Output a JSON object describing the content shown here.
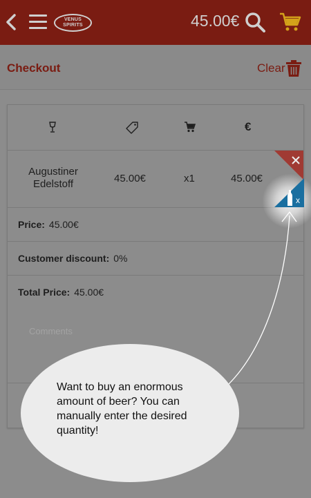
{
  "header": {
    "logo_line1": "VENUS",
    "logo_line2": "SPIRITS",
    "cart_total": "45.00€"
  },
  "subheader": {
    "title": "Checkout",
    "clear_label": "Clear"
  },
  "table": {
    "columns": [
      "glass-icon",
      "tag-icon",
      "cart-icon",
      "euro-icon"
    ],
    "euro_symbol": "€",
    "item": {
      "name": "Augustiner Edelstoff",
      "price": "45.00€",
      "quantity": "x1",
      "total": "45.00€"
    }
  },
  "summary": {
    "price_label": "Price:",
    "price_value": "45.00€",
    "discount_label": "Customer discount:",
    "discount_value": "0%",
    "total_label": "Total Price:",
    "total_value": "45.00€"
  },
  "comments_placeholder": "Comments",
  "tooltip": {
    "text": "Want to buy an enormous amount of beer? You can manually enter the desired quantity!",
    "quantity_badge": "x"
  },
  "colors": {
    "brand_red": "#7a1c12",
    "delete_red": "#a03a33",
    "quantity_blue": "#1a6fa0"
  }
}
